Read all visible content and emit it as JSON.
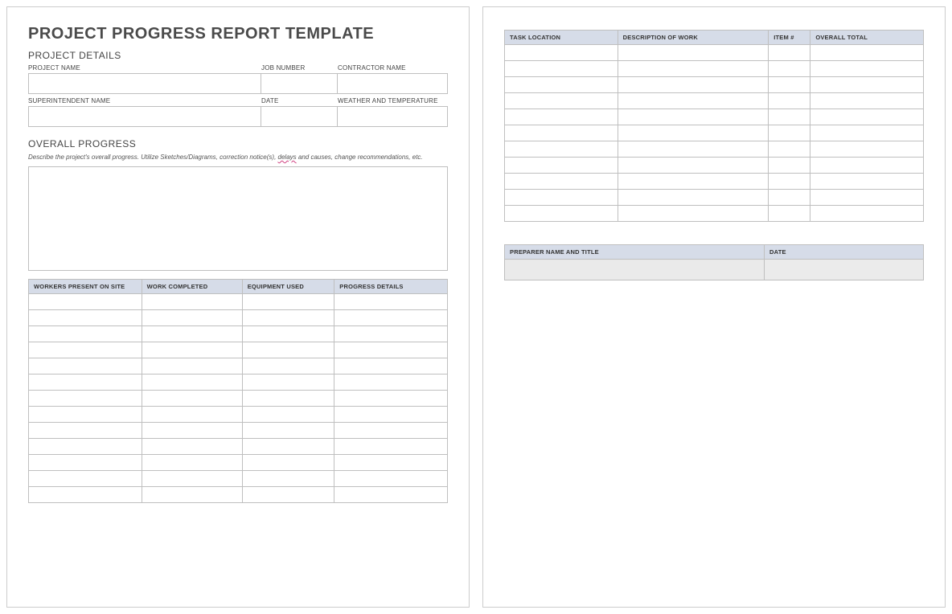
{
  "title": "PROJECT PROGRESS REPORT TEMPLATE",
  "project_details": {
    "heading": "PROJECT DETAILS",
    "row1": {
      "project_name": {
        "label": "PROJECT NAME",
        "value": ""
      },
      "job_number": {
        "label": "JOB NUMBER",
        "value": ""
      },
      "contractor_name": {
        "label": "CONTRACTOR NAME",
        "value": ""
      }
    },
    "row2": {
      "superintendent_name": {
        "label": "SUPERINTENDENT NAME",
        "value": ""
      },
      "date": {
        "label": "DATE",
        "value": ""
      },
      "weather": {
        "label": "WEATHER AND TEMPERATURE",
        "value": ""
      }
    }
  },
  "overall_progress": {
    "heading": "OVERALL PROGRESS",
    "instructions_before": "Describe the project's overall progress. Utilize Sketches/Diagrams, correction notice(s), ",
    "instructions_underlined": "delays",
    "instructions_after": " and causes, change recommendations, etc.",
    "value": ""
  },
  "workers_table": {
    "headers": [
      "WORKERS PRESENT ON SITE",
      "WORK COMPLETED",
      "EQUIPMENT USED",
      "PROGRESS DETAILS"
    ],
    "row_count": 13,
    "rows": [
      [
        "",
        "",
        "",
        ""
      ],
      [
        "",
        "",
        "",
        ""
      ],
      [
        "",
        "",
        "",
        ""
      ],
      [
        "",
        "",
        "",
        ""
      ],
      [
        "",
        "",
        "",
        ""
      ],
      [
        "",
        "",
        "",
        ""
      ],
      [
        "",
        "",
        "",
        ""
      ],
      [
        "",
        "",
        "",
        ""
      ],
      [
        "",
        "",
        "",
        ""
      ],
      [
        "",
        "",
        "",
        ""
      ],
      [
        "",
        "",
        "",
        ""
      ],
      [
        "",
        "",
        "",
        ""
      ],
      [
        "",
        "",
        "",
        ""
      ]
    ]
  },
  "task_table": {
    "headers": [
      "TASK LOCATION",
      "DESCRIPTION OF WORK",
      "ITEM #",
      "OVERALL TOTAL"
    ],
    "row_count": 11,
    "rows": [
      [
        "",
        "",
        "",
        ""
      ],
      [
        "",
        "",
        "",
        ""
      ],
      [
        "",
        "",
        "",
        ""
      ],
      [
        "",
        "",
        "",
        ""
      ],
      [
        "",
        "",
        "",
        ""
      ],
      [
        "",
        "",
        "",
        ""
      ],
      [
        "",
        "",
        "",
        ""
      ],
      [
        "",
        "",
        "",
        ""
      ],
      [
        "",
        "",
        "",
        ""
      ],
      [
        "",
        "",
        "",
        ""
      ],
      [
        "",
        "",
        "",
        ""
      ]
    ]
  },
  "signature_table": {
    "headers": [
      "PREPARER NAME AND TITLE",
      "DATE"
    ],
    "rows": [
      [
        "",
        ""
      ]
    ]
  }
}
